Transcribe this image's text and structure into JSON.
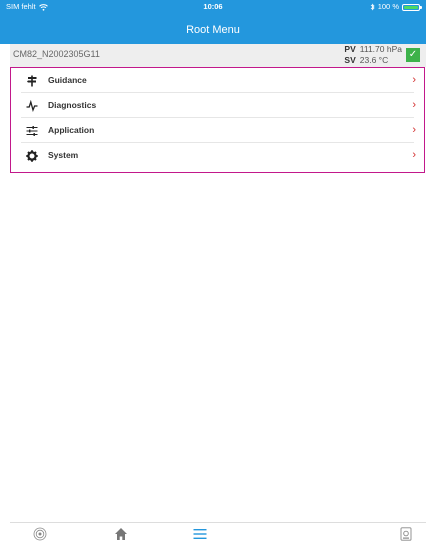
{
  "status": {
    "carrier": "SIM fehlt",
    "time": "10:06",
    "battery": "100 %"
  },
  "header": {
    "title": "Root Menu"
  },
  "device": {
    "name": "CM82_N2002305G11",
    "pv_label": "PV",
    "pv_value": "111.70 hPa",
    "sv_label": "SV",
    "sv_value": "23.6 °C",
    "status_icon": "check-icon"
  },
  "menu": {
    "items": [
      {
        "label": "Guidance",
        "icon": "signpost-icon"
      },
      {
        "label": "Diagnostics",
        "icon": "pulse-icon"
      },
      {
        "label": "Application",
        "icon": "sliders-icon"
      },
      {
        "label": "System",
        "icon": "gear-icon"
      }
    ]
  },
  "tabbar": {
    "items": [
      "radar-icon",
      "home-icon",
      "menu-icon",
      "device-icon"
    ]
  },
  "colors": {
    "header": "#2397dd",
    "accent": "#2397dd",
    "highlight_border": "#c2188b",
    "chevron": "#d32f2f",
    "ok": "#3db24a"
  }
}
